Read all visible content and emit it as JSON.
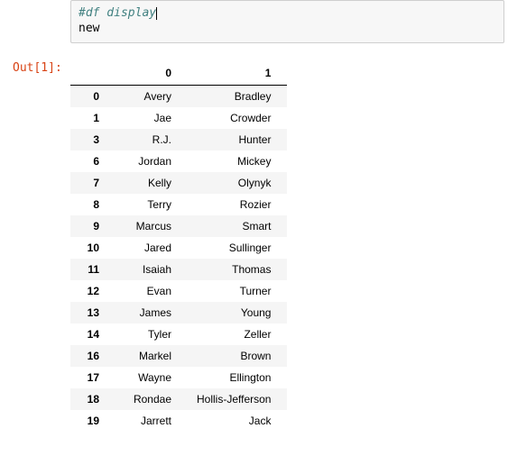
{
  "input": {
    "comment": "#df display",
    "line2": "new"
  },
  "prompt": {
    "out": "Out[1]:"
  },
  "table": {
    "headers": [
      "",
      "0",
      "1"
    ],
    "rows": [
      {
        "idx": "0",
        "c0": "Avery",
        "c1": "Bradley"
      },
      {
        "idx": "1",
        "c0": "Jae",
        "c1": "Crowder"
      },
      {
        "idx": "3",
        "c0": "R.J.",
        "c1": "Hunter"
      },
      {
        "idx": "6",
        "c0": "Jordan",
        "c1": "Mickey"
      },
      {
        "idx": "7",
        "c0": "Kelly",
        "c1": "Olynyk"
      },
      {
        "idx": "8",
        "c0": "Terry",
        "c1": "Rozier"
      },
      {
        "idx": "9",
        "c0": "Marcus",
        "c1": "Smart"
      },
      {
        "idx": "10",
        "c0": "Jared",
        "c1": "Sullinger"
      },
      {
        "idx": "11",
        "c0": "Isaiah",
        "c1": "Thomas"
      },
      {
        "idx": "12",
        "c0": "Evan",
        "c1": "Turner"
      },
      {
        "idx": "13",
        "c0": "James",
        "c1": "Young"
      },
      {
        "idx": "14",
        "c0": "Tyler",
        "c1": "Zeller"
      },
      {
        "idx": "16",
        "c0": "Markel",
        "c1": "Brown"
      },
      {
        "idx": "17",
        "c0": "Wayne",
        "c1": "Ellington"
      },
      {
        "idx": "18",
        "c0": "Rondae",
        "c1": "Hollis-Jefferson"
      },
      {
        "idx": "19",
        "c0": "Jarrett",
        "c1": "Jack"
      }
    ]
  }
}
